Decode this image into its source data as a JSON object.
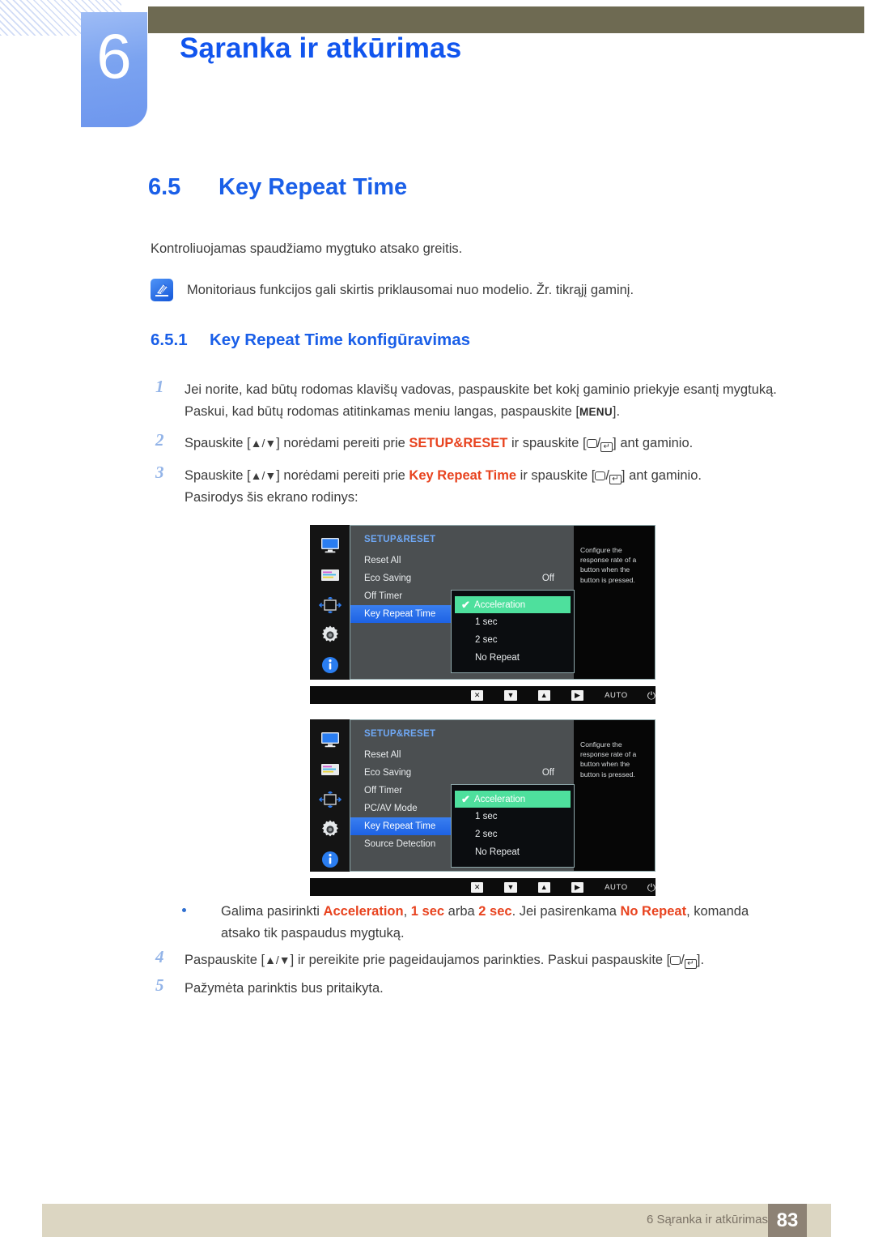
{
  "header": {
    "chapter_number": "6",
    "chapter_title": "Sąranka ir atkūrimas"
  },
  "section": {
    "number": "6.5",
    "title": "Key Repeat Time",
    "lead": "Kontroliuojamas spaudžiamo mygtuko atsako greitis.",
    "note": "Monitoriaus funkcijos gali skirtis priklausomai nuo modelio. Žr. tikrąjį gaminį.",
    "note_icon": "note-pen-icon"
  },
  "subsection": {
    "number": "6.5.1",
    "title": "Key Repeat Time konfigūravimas"
  },
  "steps": [
    {
      "num": "1",
      "lines": [
        "Jei norite, kad būtų rodomas klavišų vadovas, paspauskite bet kokį gaminio priekyje esantį mygtuką.",
        "Paskui, kad būtų rodomas atitinkamas meniu langas, paspauskite [MENU]."
      ],
      "line2_prefix": "Paskui, kad būtų rodomas atitinkamas meniu langas, paspauskite [",
      "line2_kbd": "MENU",
      "line2_suffix": "]."
    },
    {
      "num": "2",
      "pre": "Spauskite [",
      "arrows": "▲/▼",
      "mid": "] norėdami pereiti prie ",
      "kw": "SETUP&RESET",
      "mid2": " ir spauskite [",
      "post": "] ant gaminio."
    },
    {
      "num": "3",
      "pre": "Spauskite [",
      "arrows": "▲/▼",
      "mid": "] norėdami pereiti prie ",
      "kw": "Key Repeat Time",
      "mid2": " ir spauskite [",
      "post": "] ant gaminio.",
      "line2": "Pasirodys šis ekrano rodinys:"
    }
  ],
  "bullet": {
    "pre": "Galima pasirinkti ",
    "kw1": "Acceleration",
    "sep1": ", ",
    "kw2": "1 sec",
    "sep2": " arba ",
    "kw3": "2 sec",
    "sep3": ". Jei pasirenkama ",
    "kw4": "No Repeat",
    "sep4": ", komanda",
    "line2": "atsako tik paspaudus mygtuką."
  },
  "steps2": [
    {
      "num": "4",
      "pre": "Paspauskite [",
      "arrows": "▲/▼",
      "mid": "] ir pereikite prie pageidaujamos parinkties. Paskui paspauskite [",
      "post": "]."
    },
    {
      "num": "5",
      "text": "Pažymėta parinktis bus pritaikyta."
    }
  ],
  "osd": {
    "rail_icons": [
      "monitor-icon",
      "color-bars-icon",
      "size-position-icon",
      "gear-icon",
      "info-icon"
    ],
    "header_label": "SETUP&RESET",
    "help_text": "Configure the response rate of a button when the button is pressed.",
    "submenu": {
      "options": [
        "Acceleration",
        "1 sec",
        "2 sec",
        "No Repeat"
      ],
      "selected": "Acceleration",
      "check_glyph": "✔"
    },
    "buttonbar": {
      "keys": [
        "✕",
        "▼",
        "▲",
        "▶"
      ],
      "auto_label": "AUTO",
      "power_glyph": "⏻"
    },
    "screen1": {
      "rows": [
        {
          "label": "Reset All",
          "value": ""
        },
        {
          "label": "Eco Saving",
          "value": "Off"
        },
        {
          "label": "Off Timer",
          "value": ""
        },
        {
          "label": "Key Repeat Time",
          "value": "",
          "selected": true
        }
      ]
    },
    "screen2": {
      "rows": [
        {
          "label": "Reset All",
          "value": ""
        },
        {
          "label": "Eco Saving",
          "value": "Off"
        },
        {
          "label": "Off Timer",
          "value": ""
        },
        {
          "label": "PC/AV Mode",
          "value": ""
        },
        {
          "label": "Key Repeat Time",
          "value": "",
          "selected": true
        },
        {
          "label": "Source Detection",
          "value": ""
        }
      ]
    }
  },
  "footer": {
    "text": "6 Sąranka ir atkūrimas",
    "page": "83"
  },
  "colors": {
    "accent_blue": "#1155ee",
    "keyword_red": "#e8431f",
    "olive": "#6e6a52",
    "footer_bg": "#dcd6c2",
    "footer_page_bg": "#8d8275",
    "osd_select_blue": "#1d62e4",
    "osd_option_green": "#4ee09d"
  }
}
